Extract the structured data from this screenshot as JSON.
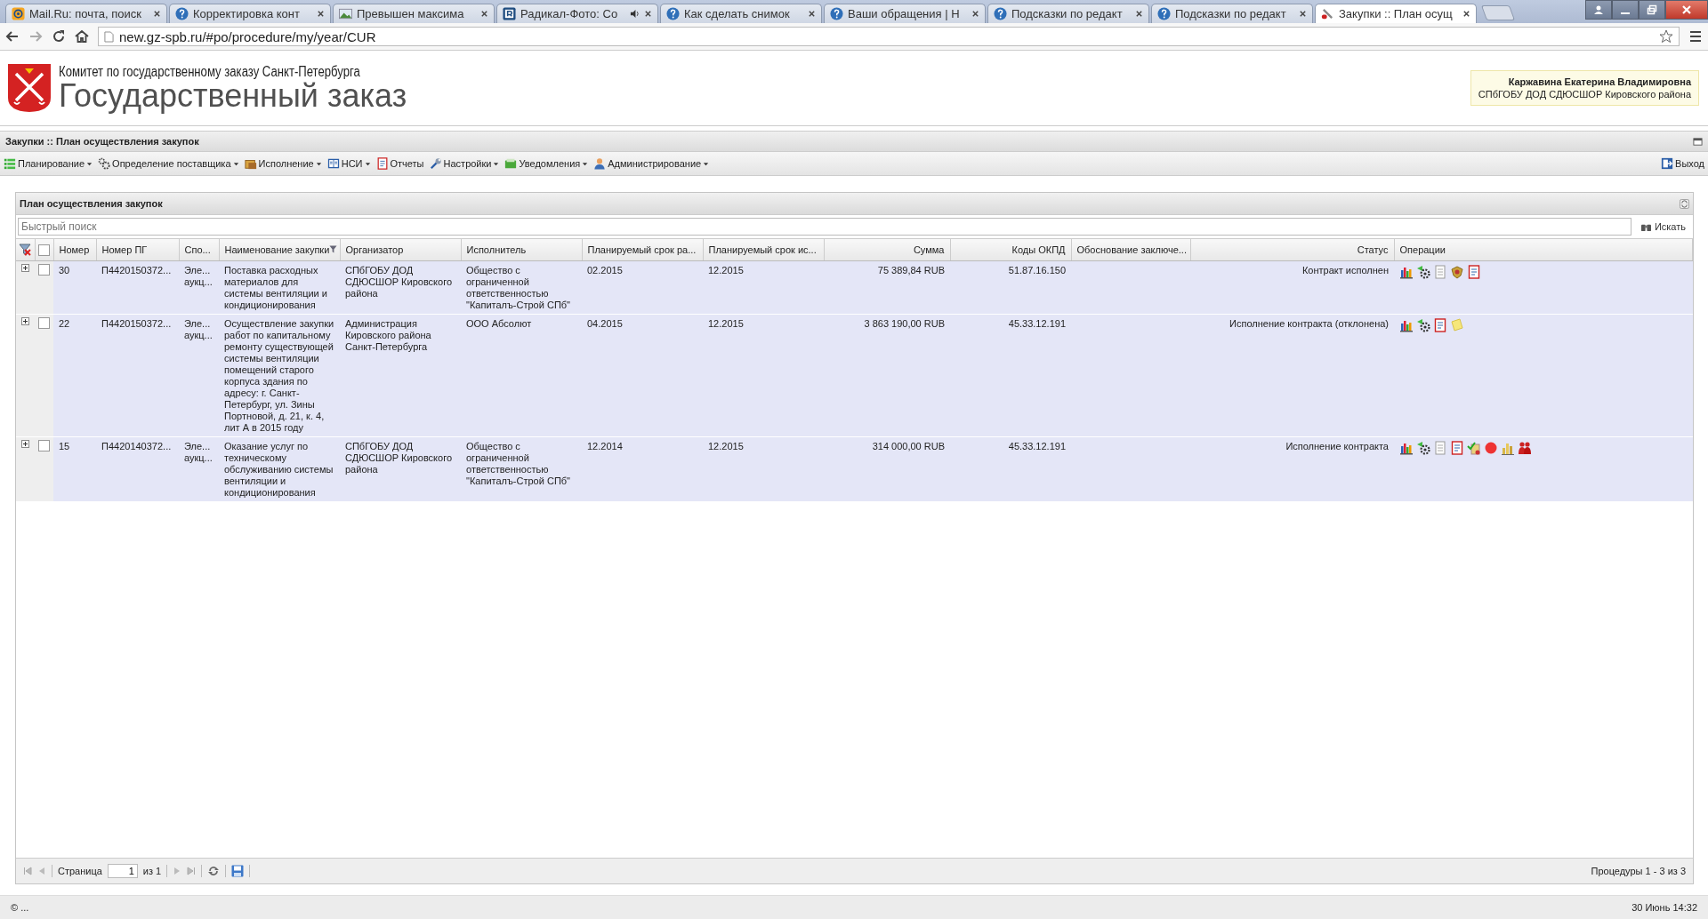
{
  "browser": {
    "tabs": [
      {
        "title": "Mail.Ru: почта, поиск",
        "kind": "mail",
        "audio": false,
        "selected": false
      },
      {
        "title": "Корректировка конт",
        "kind": "help",
        "audio": false,
        "selected": false
      },
      {
        "title": "Превышен максима",
        "kind": "image",
        "audio": false,
        "selected": false
      },
      {
        "title": "Радикал-Фото: Co",
        "kind": "radikal",
        "audio": true,
        "selected": false
      },
      {
        "title": "Как сделать снимок",
        "kind": "help",
        "audio": false,
        "selected": false
      },
      {
        "title": "Ваши обращения | Н",
        "kind": "help",
        "audio": false,
        "selected": false
      },
      {
        "title": "Подсказки по редакт",
        "kind": "help",
        "audio": false,
        "selected": false
      },
      {
        "title": "Подсказки по редакт",
        "kind": "help",
        "audio": false,
        "selected": false
      },
      {
        "title": "Закупки :: План осущ",
        "kind": "tool",
        "audio": false,
        "selected": true
      }
    ],
    "address": "new.gz-spb.ru/#po/procedure/my/year/CUR"
  },
  "header": {
    "subtitle": "Комитет по государственному заказу Санкт-Петербурга",
    "title": "Государственный заказ",
    "user": {
      "name": "Каржавина Екатерина Владимировна",
      "org": "СПбГОБУ ДОД СДЮСШОР Кировского района"
    }
  },
  "app_title": "Закупки :: План осуществления закупок",
  "menu": [
    {
      "label": "Планирование",
      "kind": "plan",
      "dropdown": true
    },
    {
      "label": "Определение поставщика",
      "kind": "gears",
      "dropdown": true
    },
    {
      "label": "Исполнение",
      "kind": "folder",
      "dropdown": true
    },
    {
      "label": "НСИ",
      "kind": "book",
      "dropdown": true
    },
    {
      "label": "Отчеты",
      "kind": "report",
      "dropdown": false
    },
    {
      "label": "Настройки",
      "kind": "wrench",
      "dropdown": true
    },
    {
      "label": "Уведомления",
      "kind": "notice",
      "dropdown": true
    },
    {
      "label": "Администрирование",
      "kind": "user",
      "dropdown": true
    }
  ],
  "logout": "Выход",
  "panel": {
    "title": "План осуществления закупок",
    "all_selected": false,
    "search": {
      "placeholder": "Быстрый поиск",
      "button": "Искать"
    },
    "columns": [
      {
        "label": "Номер",
        "filtered": false
      },
      {
        "label": "Номер ПГ",
        "filtered": false
      },
      {
        "label": "Спо...",
        "filtered": false
      },
      {
        "label": "Наименование закупки",
        "filtered": true
      },
      {
        "label": "Организатор",
        "filtered": false
      },
      {
        "label": "Исполнитель",
        "filtered": false
      },
      {
        "label": "Планируемый срок ра...",
        "filtered": false
      },
      {
        "label": "Планируемый срок ис...",
        "filtered": false
      },
      {
        "label": "Сумма",
        "filtered": false
      },
      {
        "label": "Коды ОКПД",
        "filtered": false
      },
      {
        "label": "Обоснование заключе...",
        "filtered": false
      },
      {
        "label": "Статус",
        "filtered": false
      },
      {
        "label": "Операции",
        "filtered": false
      }
    ],
    "rows": [
      {
        "selected": false,
        "number": "30",
        "pg_number": "П4420150372...",
        "method": "Эле... аукц...",
        "name": "Поставка расходных материалов для системы вентиляции и кондиционирования",
        "organizer": "СПбГОБУ ДОД СДЮСШОР Кировского района",
        "executor": "Общество с ограниченной ответственностью \"Капиталъ-Строй СПб\"",
        "start": "02.2015",
        "end": "12.2015",
        "sum": "75 389,84 RUB",
        "okpd": "51.87.16.150",
        "status": "Контракт исполнен",
        "operations": [
          {
            "kind": "chart"
          },
          {
            "kind": "gear"
          },
          {
            "kind": "doc"
          },
          {
            "kind": "emblem"
          },
          {
            "kind": "notebook"
          }
        ]
      },
      {
        "selected": false,
        "number": "22",
        "pg_number": "П4420150372...",
        "method": "Эле... аукц...",
        "name": "Осуществление закупки работ по капитальному ремонту существующей системы вентиляции помещений старого корпуса здания по адресу: г. Санкт-Петербург, ул. Зины Портновой, д. 21, к. 4, лит А в 2015 году",
        "organizer": "Администрация Кировского района Санкт-Петербурга",
        "executor": "ООО Абсолют",
        "start": "04.2015",
        "end": "12.2015",
        "sum": "3 863 190,00 RUB",
        "okpd": "45.33.12.191",
        "status": "Исполнение контракта (отклонена)",
        "operations": [
          {
            "kind": "chart"
          },
          {
            "kind": "gear"
          },
          {
            "kind": "notebook"
          },
          {
            "kind": "note"
          }
        ]
      },
      {
        "selected": false,
        "number": "15",
        "pg_number": "П4420140372...",
        "method": "Эле... аукц...",
        "name": "Оказание услуг по техническому обслуживанию системы вентиляции и кондиционирования",
        "organizer": "СПбГОБУ ДОД СДЮСШОР Кировского района",
        "executor": "Общество с ограниченной ответственностью \"Капиталъ-Строй СПб\"",
        "start": "12.2014",
        "end": "12.2015",
        "sum": "314 000,00 RUB",
        "okpd": "45.33.12.191",
        "status": "Исполнение контракта",
        "operations": [
          {
            "kind": "chart"
          },
          {
            "kind": "gear"
          },
          {
            "kind": "doc"
          },
          {
            "kind": "notebook"
          },
          {
            "kind": "check"
          },
          {
            "kind": "record"
          },
          {
            "kind": "bars"
          },
          {
            "kind": "people"
          }
        ]
      }
    ]
  },
  "pager": {
    "page_label": "Страница",
    "page": "1",
    "of": "из 1",
    "summary": "Процедуры 1 - 3 из 3"
  },
  "status_bar": {
    "left": "© ...",
    "right": "30 Июнь 14:32"
  }
}
